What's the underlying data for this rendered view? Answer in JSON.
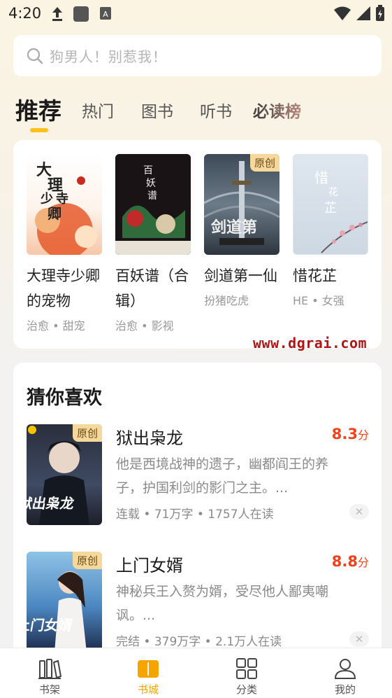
{
  "status_bar": {
    "time": "4:20"
  },
  "search": {
    "placeholder": "狗男人！别惹我！"
  },
  "tabs": [
    {
      "label": "推荐",
      "active": true
    },
    {
      "label": "热门"
    },
    {
      "label": "图书"
    },
    {
      "label": "听书"
    },
    {
      "label": "必读榜"
    }
  ],
  "recommend": [
    {
      "title": "大理寺少卿的宠物",
      "tags": "治愈 • 甜宠",
      "cover_text": "大理寺少卿"
    },
    {
      "title": "百妖谱（合辑）",
      "tags": "治愈 • 影视",
      "cover_text": "百妖谱"
    },
    {
      "title": "剑道第一仙",
      "tags": "扮猪吃虎",
      "badge": "原创",
      "cover_text": "剑道第一仙"
    },
    {
      "title": "惜花芷",
      "tags": "HE • 女强",
      "cover_text": "惜花芷"
    }
  ],
  "watermark": "www.dgrai.com",
  "guess": {
    "heading": "猜你喜欢",
    "items": [
      {
        "title": "狱出枭龙",
        "score": "8.3",
        "score_unit": "分",
        "desc": "他是西境战神的遗子，幽都阎王的养子，护国利剑的影门之主。...",
        "meta": "连载 • 71万字 • 1757人在读",
        "badge": "原创",
        "cover_text": "狱出枭龙"
      },
      {
        "title": "上门女婿",
        "score": "8.8",
        "score_unit": "分",
        "desc": "神秘兵王入赘为婿，受尽他人鄙夷嘲讽。...",
        "meta": "完结 • 379万字 • 2.1万人在读",
        "badge": "原创",
        "cover_text": "上门女婿"
      }
    ]
  },
  "bottom_nav": [
    {
      "label": "书架",
      "icon": "bookshelf-icon"
    },
    {
      "label": "书城",
      "icon": "bookstore-icon",
      "active": true
    },
    {
      "label": "分类",
      "icon": "category-grid-icon"
    },
    {
      "label": "我的",
      "icon": "profile-icon"
    }
  ],
  "colors": {
    "accent": "#ffc21c",
    "score": "#f2421b",
    "nav_active": "#f5a400"
  }
}
